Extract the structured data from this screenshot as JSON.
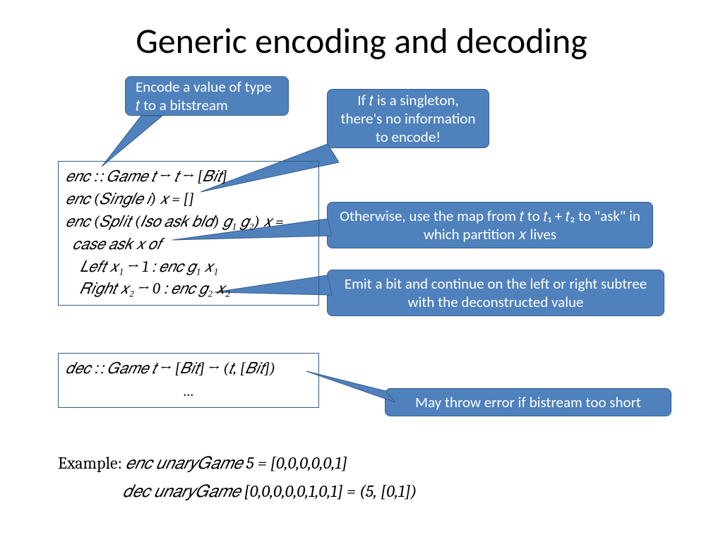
{
  "title": "Generic encoding and decoding",
  "callouts": {
    "encode_hint": "Encode a value of type 𝑡 to a bitstream",
    "singleton_hint": "If 𝑡 is a singleton, there's no information to encode!",
    "otherwise_hint": "Otherwise, use the map from 𝑡 to 𝑡₁ + 𝑡₂ to \"ask\" in which partition 𝑥 lives",
    "emit_hint": "Emit a bit and continue on the left or right subtree with the deconstructed value",
    "error_hint": "May throw error if bistream too short"
  },
  "enc_box": {
    "sig": "𝑒𝑛𝑐  ∷ 𝐺𝑎𝑚𝑒 𝑡  → 𝑡  → [𝐵𝑖𝑡]",
    "l2": "𝑒𝑛𝑐 (𝑆𝑖𝑛𝑔𝑙𝑒 𝑖)  𝑥 = []",
    "l3": "𝑒𝑛𝑐 (𝑆𝑝𝑙𝑖𝑡 (𝐼𝑠𝑜 𝑎𝑠𝑘 𝑏𝑙𝑑) 𝑔₁ 𝑔₂) 𝑥 =",
    "l4": " 𝑐𝑎𝑠𝑒 𝑎𝑠𝑘 𝑥 𝑜𝑓",
    "l5": "  𝐿𝑒𝑓𝑡   𝑥₁ → 1 ∶ 𝑒𝑛𝑐 𝑔₁ 𝑥₁",
    "l6": "  𝑅𝑖𝑔ℎ𝑡 𝑥₂ → 0 ∶ 𝑒𝑛𝑐 𝑔₂ 𝑥₂"
  },
  "dec_box": {
    "sig": "𝑑𝑒𝑐  ∷ 𝐺𝑎𝑚𝑒 𝑡  → [𝐵𝑖𝑡]  → (𝑡, [𝐵𝑖𝑡])",
    "body": "…"
  },
  "example": {
    "label": "Example:",
    "line1": "𝑒𝑛𝑐 𝑢𝑛𝑎𝑟𝑦𝐺𝑎𝑚𝑒 5 =  [0,0,0,0,0,1]",
    "line2": "𝑑𝑒𝑐 𝑢𝑛𝑎𝑟𝑦𝐺𝑎𝑚𝑒 [0,0,0,0,0,1,0,1] = (5, [0,1])"
  }
}
